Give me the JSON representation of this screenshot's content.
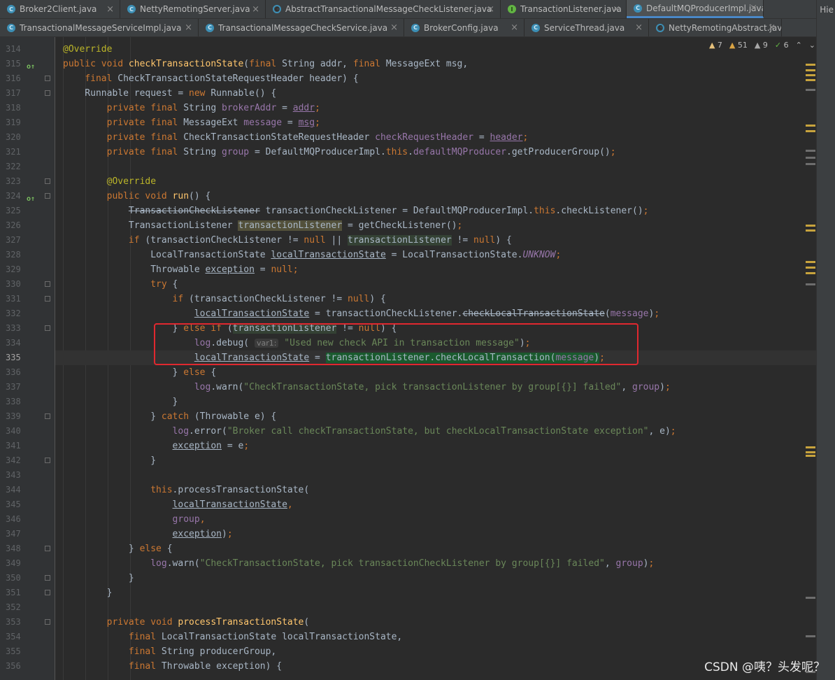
{
  "tabs_row1": [
    {
      "label": "Broker2Client.java",
      "icon": "class-icon",
      "active": false
    },
    {
      "label": "NettyRemotingServer.java",
      "icon": "class-icon",
      "active": false
    },
    {
      "label": "AbstractTransactionalMessageCheckListener.java",
      "icon": "abstract-class-icon",
      "active": false
    },
    {
      "label": "TransactionListener.java",
      "icon": "interface-icon",
      "active": false
    },
    {
      "label": "DefaultMQProducerImpl.java",
      "icon": "class-icon",
      "active": true
    }
  ],
  "tabs_row2": [
    {
      "label": "TransactionalMessageServiceImpl.java",
      "icon": "class-icon"
    },
    {
      "label": "TransactionalMessageCheckService.java",
      "icon": "class-icon"
    },
    {
      "label": "BrokerConfig.java",
      "icon": "class-icon"
    },
    {
      "label": "ServiceThread.java",
      "icon": "class-icon"
    },
    {
      "label": "NettyRemotingAbstract.java",
      "icon": "abstract-class-icon"
    }
  ],
  "close_symbol": "×",
  "hierarchy_label": "Hie",
  "inspections": {
    "warnings_yellow": "7",
    "warnings_orange": "51",
    "weak_warnings": "9",
    "typos": "6"
  },
  "current_line": "335",
  "line_numbers": [
    "314",
    "315",
    "316",
    "317",
    "318",
    "319",
    "320",
    "321",
    "322",
    "323",
    "324",
    "325",
    "326",
    "327",
    "328",
    "329",
    "330",
    "331",
    "332",
    "333",
    "334",
    "335",
    "336",
    "337",
    "338",
    "339",
    "340",
    "341",
    "342",
    "343",
    "344",
    "345",
    "346",
    "347",
    "348",
    "349",
    "350",
    "351",
    "352",
    "353",
    "354",
    "355",
    "356"
  ],
  "hint": {
    "param_name": "var1:"
  },
  "strings": {
    "debug_msg": "\"Used new check API in transaction message\"",
    "warn_listener": "\"CheckTransactionState, pick transactionListener by group[{}] failed\"",
    "error_msg": "\"Broker call checkTransactionState, but checkLocalTransactionState exception\"",
    "warn_check_listener": "\"CheckTransactionState, pick transactionCheckListener by group[{}] failed\""
  },
  "watermark": "CSDN @咦？头发呢？",
  "colors": {
    "keyword": "#cc7832",
    "string": "#6a8759",
    "method": "#ffc66d",
    "field": "#9876aa",
    "annotation": "#bbb529",
    "red_box": "#e0282f",
    "active_tab_underline": "#4a88c7"
  }
}
